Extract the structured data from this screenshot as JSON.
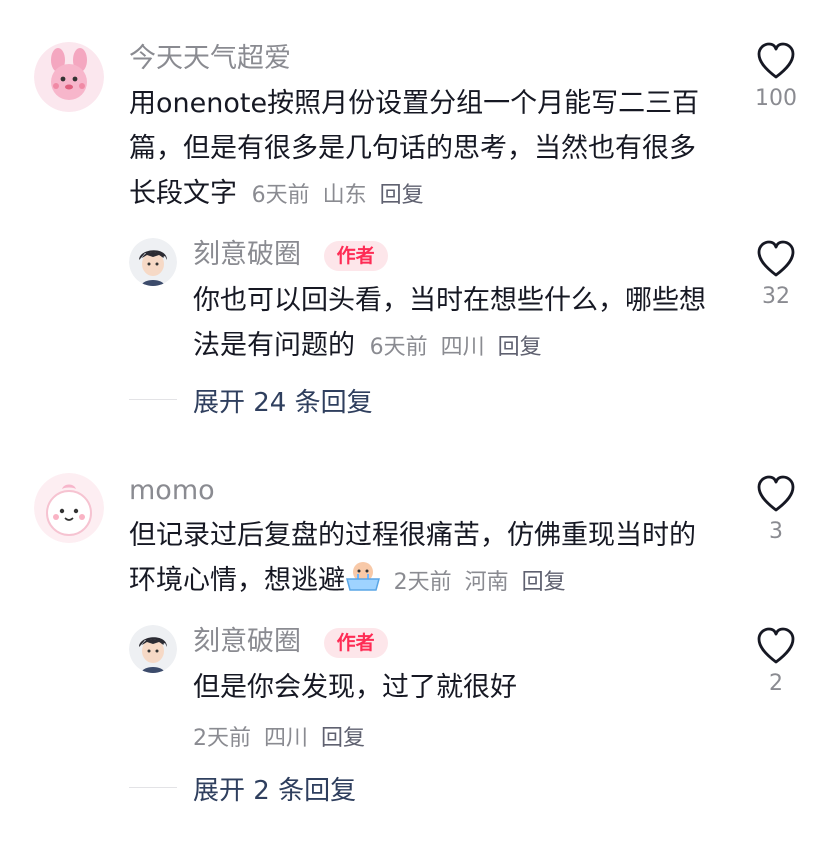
{
  "comments": [
    {
      "author": "今天天气超爱",
      "text_main": "用onenote按照月份设置分组一个月能写二三百篇，但是有很多是几句话的思考，当然也有很多长段文字",
      "time": "6天前",
      "location": "山东",
      "reply_label": "回复",
      "likes": "100",
      "reply": {
        "author": "刻意破圈",
        "badge": "作者",
        "text": "你也可以回头看，当时在想些什么，哪些想法是有问题的",
        "time": "6天前",
        "location": "四川",
        "reply_label": "回复",
        "likes": "32"
      },
      "expand_label": "展开 24 条回复"
    },
    {
      "author": "momo",
      "text_main": "但记录过后复盘的过程很痛苦，仿佛重现当时的环境心情，想逃避",
      "emoji": "crying-bath-emoji",
      "time": "2天前",
      "location": "河南",
      "reply_label": "回复",
      "likes": "3",
      "reply": {
        "author": "刻意破圈",
        "badge": "作者",
        "text": "但是你会发现，过了就很好",
        "time": "2天前",
        "location": "四川",
        "reply_label": "回复",
        "likes": "2"
      },
      "expand_label": "展开 2 条回复"
    }
  ],
  "colors": {
    "author_badge_bg": "#fde6ea",
    "author_badge_text": "#fe2c55",
    "expand_text": "#2f3f5e",
    "meta_text": "#8a8b91"
  }
}
